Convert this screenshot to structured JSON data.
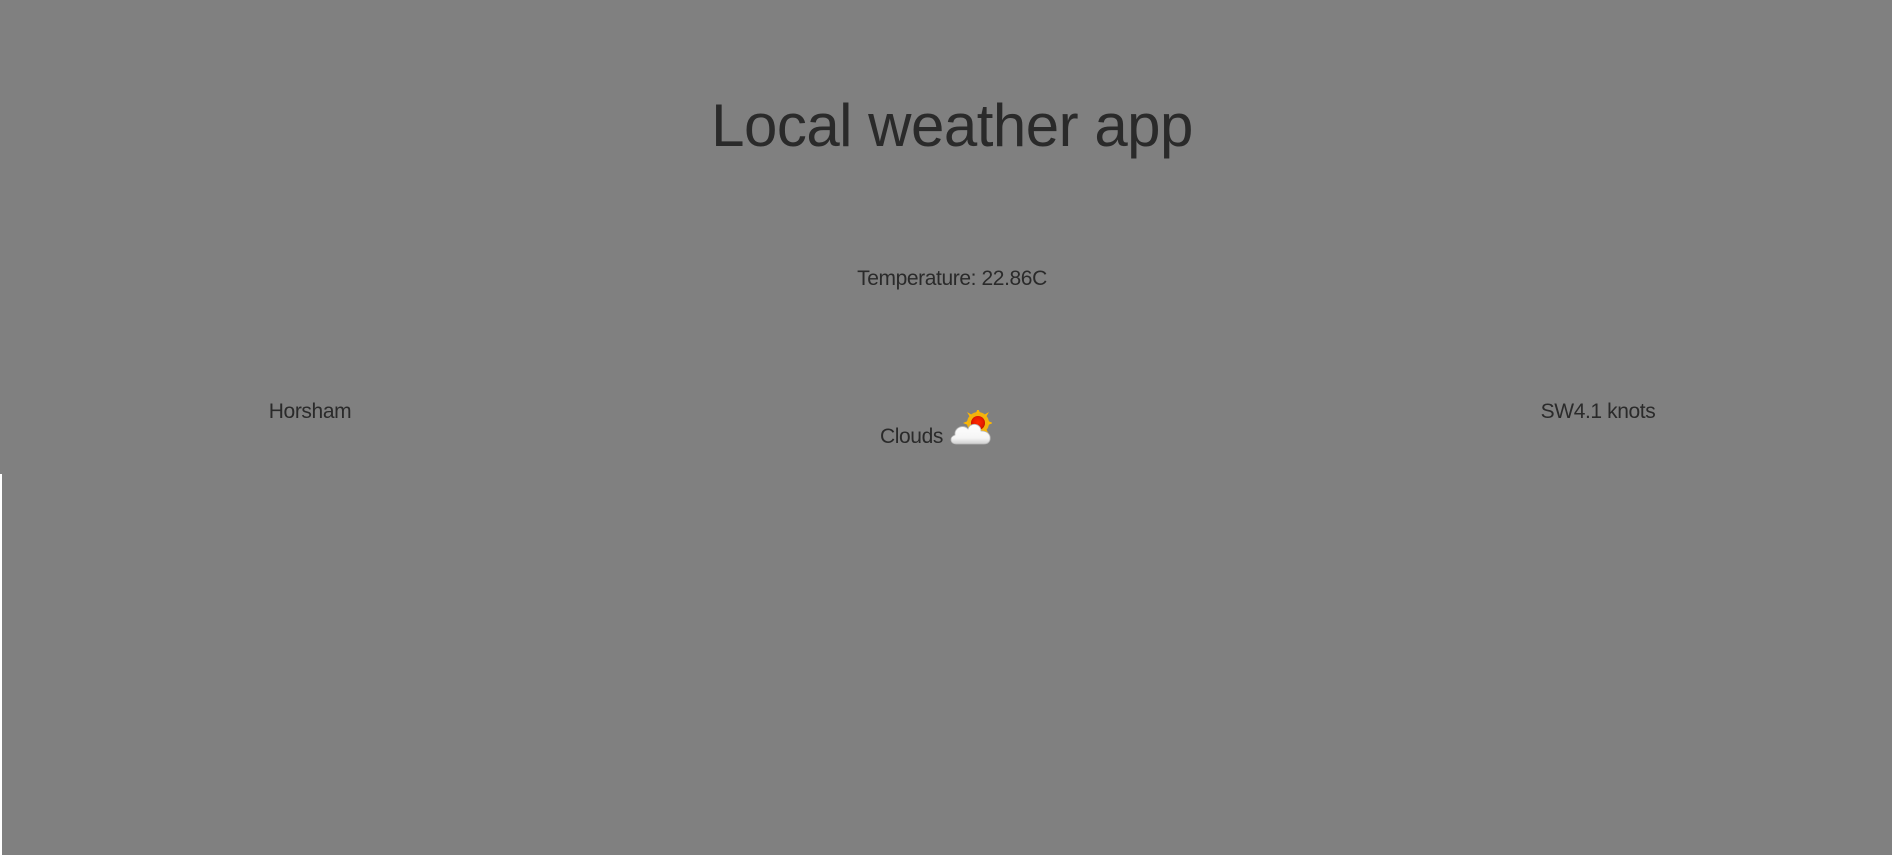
{
  "app": {
    "title": "Local weather app"
  },
  "weather": {
    "temperature_text": "Temperature: 22.86C",
    "location": "Horsham",
    "condition": "Clouds",
    "condition_icon": "partly-cloudy-icon",
    "wind_text": "SW4.1 knots"
  },
  "colors": {
    "background": "#808080",
    "text": "#2a2a2a",
    "page_edge": "#ffffff"
  }
}
